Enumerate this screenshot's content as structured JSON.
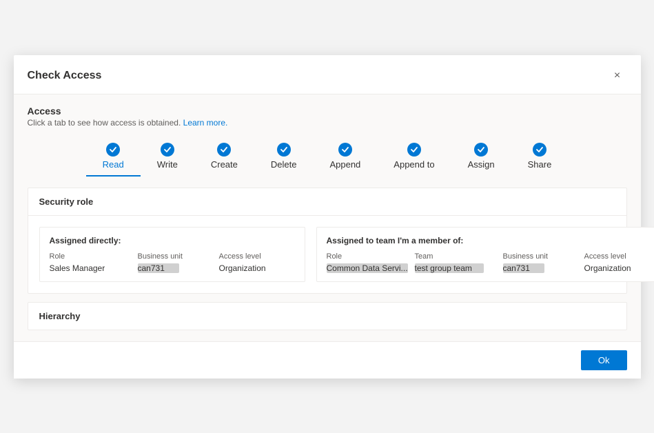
{
  "dialog": {
    "title": "Check Access",
    "close_label": "×"
  },
  "access": {
    "heading": "Access",
    "subtext": "Click a tab to see how access is obtained.",
    "learn_more": "Learn more."
  },
  "tabs": [
    {
      "label": "Read",
      "active": true
    },
    {
      "label": "Write",
      "active": false
    },
    {
      "label": "Create",
      "active": false
    },
    {
      "label": "Delete",
      "active": false
    },
    {
      "label": "Append",
      "active": false
    },
    {
      "label": "Append to",
      "active": false
    },
    {
      "label": "Assign",
      "active": false
    },
    {
      "label": "Share",
      "active": false
    }
  ],
  "security_role": {
    "section_title": "Security role",
    "assigned_directly": {
      "title": "Assigned directly:",
      "columns": {
        "role": "Role",
        "business_unit": "Business unit",
        "access_level": "Access level"
      },
      "rows": [
        {
          "role_prefix": "Sales",
          "role_suffix": " Manager",
          "business_unit": "can731",
          "access_level": "Organization"
        }
      ]
    },
    "assigned_team": {
      "title": "Assigned to team I'm a member of:",
      "columns": {
        "role": "Role",
        "team": "Team",
        "business_unit": "Business unit",
        "access_level": "Access level"
      },
      "rows": [
        {
          "role": "Common Data Servi...",
          "team": "test group team",
          "business_unit": "can731",
          "access_level": "Organization"
        }
      ]
    }
  },
  "hierarchy": {
    "section_title": "Hierarchy"
  },
  "footer": {
    "ok_label": "Ok"
  }
}
